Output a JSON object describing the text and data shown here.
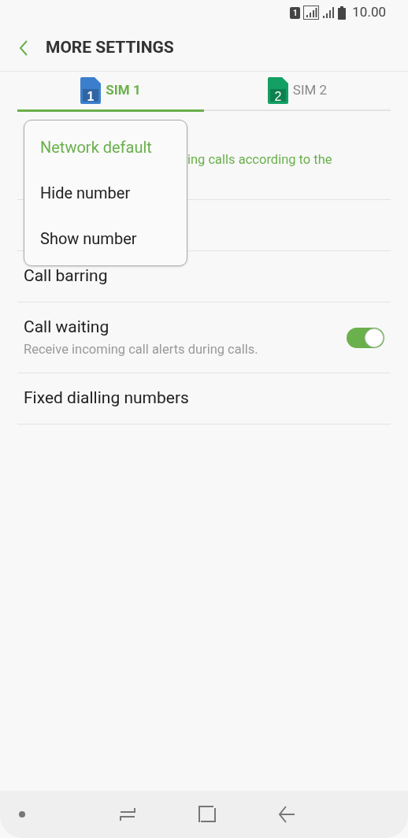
{
  "status_bar": {
    "sim_badge": "1",
    "time": "10.00"
  },
  "header": {
    "title": "MORE SETTINGS"
  },
  "tabs": [
    {
      "label": "SIM 1",
      "badge": "1",
      "color": "#3b7fcc",
      "selected": true
    },
    {
      "label": "SIM 2",
      "badge": "2",
      "color": "#12a064",
      "selected": false
    }
  ],
  "settings": [
    {
      "kind": "covered",
      "subtitle": "ing calls according to the"
    },
    {
      "kind": "plain",
      "title": "Call barring"
    },
    {
      "kind": "toggle",
      "title": "Call waiting",
      "subtitle": "Receive incoming call alerts during calls.",
      "on": true
    },
    {
      "kind": "plain",
      "title": "Fixed dialling numbers"
    }
  ],
  "popup": {
    "options": [
      {
        "label": "Network default",
        "selected": true
      },
      {
        "label": "Hide number",
        "selected": false
      },
      {
        "label": "Show number",
        "selected": false
      }
    ]
  }
}
